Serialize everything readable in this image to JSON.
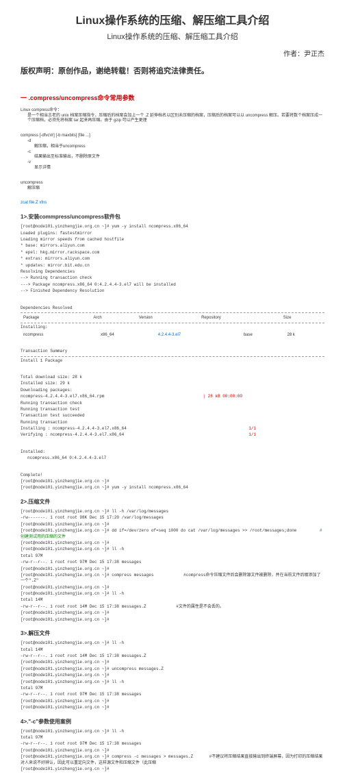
{
  "title": "Linux操作系统的压缩、解压缩工具介绍",
  "subtitle": "Linux操作系统的压缩、解压缩工具介绍",
  "author": "作者：尹正杰",
  "copyright": "版权声明：原创作品，谢绝转载！否则将追究法律责任。",
  "sec1": "一 .compress/uncompress命令常用参数",
  "intro1": "Linux compress命令：",
  "intro2": "是一个相当古老的 unix 档案压缩指令，压缩后的档案会加上一个 .Z 延伸档名以区别未压缩的档案，压缩后的档案可以以 uncompress 解压。若要将数个档案压成一个压缩档，必须先将档案 tar 起来再压缩。由于 gzip 可以产生更理",
  "usage_label": "compress [-dfvcVr] [-b maxbits] [file ...]",
  "opt_d": "解压缩，相当于uncompress",
  "opt_c": "结果输出至标准输出，不删除原文件",
  "opt_v": "显示详情",
  "uncomp": "uncompress",
  "uncomp_desc": "解压缩",
  "zcat": "zcat file.Z  xfns",
  "h1": "1>.安装commpress/uncompress软件包",
  "yum_cmd": "[root@node101.yinzhengjie.org.cn ~]# yum -y install ncompress.x86_64",
  "yum1": "Loaded plugins: fastestmirror",
  "yum2": "Loading mirror speeds from cached hostfile",
  "yum3": "* base: mirrors.aliyun.com",
  "yum4": "* epel: hkg.mirror.rackspace.com",
  "yum5": "* extras: mirrors.aliyun.com",
  "yum6": "* updates: mirror.bit.edu.cn",
  "yum7": "Resolving Dependencies",
  "yum8": "--> Running transaction check",
  "yum9": "---> Package ncompress.x86_64 0:4.2.4.4-3.el7 will be installed",
  "yum10": "--> Finished Dependency Resolution",
  "deps": "Dependencies Resolved",
  "pkg_h1": "Package",
  "pkg_h2": "Arch",
  "pkg_h3": "Version",
  "pkg_h4": "Repository",
  "pkg_h5": "Size",
  "pkg_r1": "Installing:",
  "pkg_p": "ncompress",
  "pkg_a": "x86_64",
  "pkg_v": "4.2.4.4-3.el7",
  "pkg_repo": "base",
  "pkg_s": "28 k",
  "trans": "Transaction Summary",
  "install_line": "Install  1 Package",
  "total1": "Total download size: 28 k",
  "total2": "Installed size: 29 k",
  "dl": "Downloading packages:",
  "dl_file": "ncompress-4.2.4.4-3.el7.x86_64.rpm",
  "dl_size": "| 28 kB  00:00:00",
  "rtc": "Running transaction check",
  "rtt": "Running transaction test",
  "tts": "Transaction test succeeded",
  "rt": "Running transaction",
  "inst": "Installing : ncompress-4.2.4.4-3.el7.x86_64",
  "inst_n": "1/1",
  "verf": "Verifying  : ncompress-4.2.4.4-3.el7.x86_64",
  "verf_n": "1/1",
  "installed": "Installed:",
  "installed_pkg": "ncompress.x86_64 0:4.2.4.4-3.el7",
  "complete": "Complete!",
  "prompt_end": "[root@node101.yinzhengjie.org.cn ~]#",
  "yum_full": "[root@node101.yinzhengjie.org.cn ~]# yum -y install ncompress.x86_64",
  "h2": "2>.压缩文件",
  "c1": "[root@node101.yinzhengjie.org.cn ~]# ll -h /var/log/messages",
  "c2": "-rw-------. 1 root root 98K Dec 15 17:20 /var/log/messages",
  "c3": "[root@node101.yinzhengjie.org.cn ~]#",
  "c4": "[root@node101.yinzhengjie.org.cn ~]# dd if=/dev/zero of=seq 1000  do cat /var/log/messages >> /root/messages;done",
  "c4_note": "#创建测试用的压缩的文件",
  "c5": "[root@node101.yinzhengjie.org.cn ~]#",
  "c6": "[root@node101.yinzhengjie.org.cn ~]# ll -h",
  "c7": "total 97M",
  "c8": "-rw-r--r--. 1 root root 97M Dec 15 17:38 messages",
  "c9": "[root@node101.yinzhengjie.org.cn ~]#",
  "c10": "[root@node101.yinzhengjie.org.cn ~]# compress messages",
  "c10_note": "#compress命令压缩文件后会删除源文件被删除，并在当前文件后缀添加了一个\".Z\"",
  "c11": "[root@node101.yinzhengjie.org.cn ~]#",
  "c12": "[root@node101.yinzhengjie.org.cn ~]# ll -h",
  "c13": "total 14M",
  "c14": "-rw-r--r--. 1 root root 14M Dec 15 17:38 messages.Z",
  "c14_note": "#文件的属性是不会丢的。",
  "c15": "[root@node101.yinzhengjie.org.cn ~]#",
  "c16": "[root@node101.yinzhengjie.org.cn ~]#",
  "h3": "3>.解压文件",
  "d1": "[root@node101.yinzhengjie.org.cn ~]# ll -h",
  "d2": "total 14M",
  "d3": "-rw-r--r--. 1 root root 14M Dec 15 17:38 messages.Z",
  "d4": "[root@node101.yinzhengjie.org.cn ~]#",
  "d5": "[root@node101.yinzhengjie.org.cn ~]# uncompress messages.Z",
  "d6": "[root@node101.yinzhengjie.org.cn ~]#",
  "d7": "[root@node101.yinzhengjie.org.cn ~]# ll -h",
  "d8": "total 97M",
  "d9": "-rw-r--r--. 1 root root 97M Dec 15 17:38 messages",
  "d10": "[root@node101.yinzhengjie.org.cn ~]#",
  "d11": "[root@node101.yinzhengjie.org.cn ~]#",
  "h4": "4>.\"-c\"参数使用案例",
  "e1": "[root@node101.yinzhengjie.org.cn ~]# ll -h",
  "e2": "total 97M",
  "e3": "-rw-r--r--. 1 root root 97M Dec 15 17:38 messages",
  "e4": "[root@node101.yinzhengjie.org.cn ~]#",
  "e5": "[root@node101.yinzhengjie.org.cn ~]# compress -c messages > messages.Z",
  "e5_note": "#不建议将压缩结果直接输出到终端屏幕，因为打印的压缩结果对人来说不好辨认，因此可以重定向文件，这样源文件和压缩文件（此压缩",
  "e6": "[root@node101.yinzhengjie.org.cn ~]#"
}
